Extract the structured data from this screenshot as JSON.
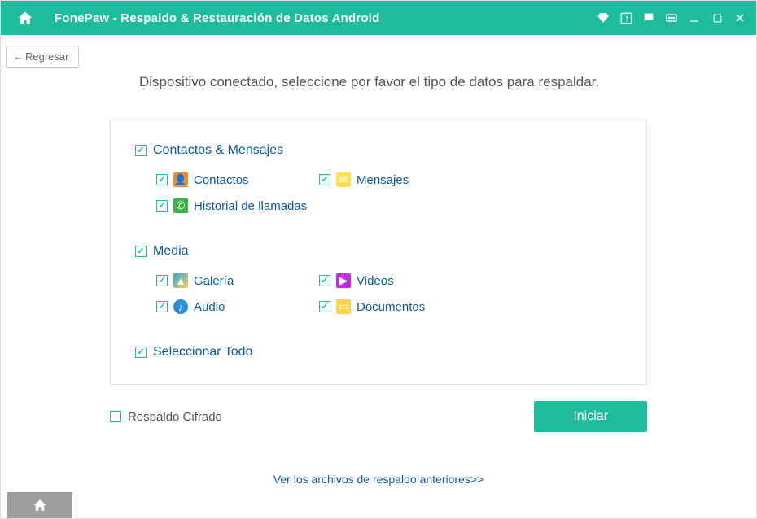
{
  "titlebar": {
    "title": "FonePaw -  Respaldo & Restauración de Datos Android"
  },
  "back_button": "Regresar",
  "instruction": "Dispositivo conectado, seleccione por favor el tipo de datos para respaldar.",
  "groups": {
    "contacts_messages": {
      "label": "Contactos & Mensajes",
      "items": {
        "contacts": "Contactos",
        "messages": "Mensajes",
        "call_history": "Historial de llamadas"
      }
    },
    "media": {
      "label": "Media",
      "items": {
        "gallery": "Galería",
        "videos": "Videos",
        "audio": "Audio",
        "documents": "Documentos"
      }
    },
    "select_all": "Seleccionar Todo"
  },
  "encrypted_backup": "Respaldo Cifrado",
  "start_button": "Iniciar",
  "previous_link": "Ver los archivos de respaldo anteriores>>"
}
